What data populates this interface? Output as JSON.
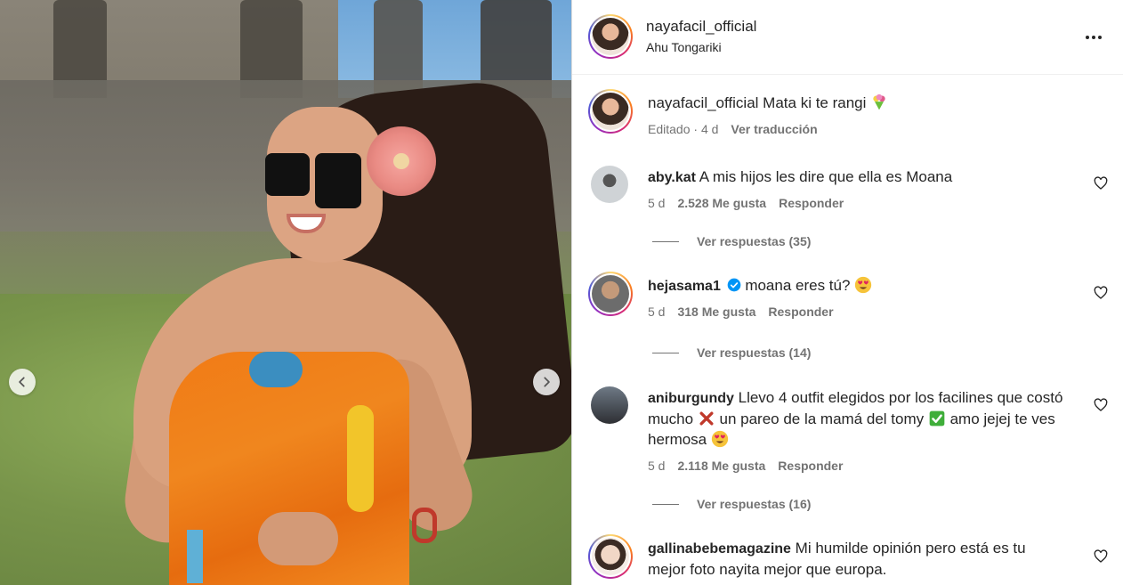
{
  "post": {
    "author": "nayafacil_official",
    "location": "Ahu Tongariki",
    "caption": {
      "username": "nayafacil_official",
      "text": "Mata ki te rangi",
      "emoji": "bouquet-icon",
      "edited_label": "Editado",
      "age": "4 d",
      "translate_label": "Ver traducción"
    }
  },
  "comments": [
    {
      "username": "aby.kat",
      "text": "A mis hijos les dire que ella es Moana",
      "age": "5 d",
      "likes": "2.528 Me gusta",
      "reply_label": "Responder",
      "view_replies": "Ver respuestas (35)"
    },
    {
      "username": "hejasama1",
      "verified": true,
      "text": "moana eres tú?",
      "emoji": "heart-eyes-icon",
      "age": "5 d",
      "likes": "318 Me gusta",
      "reply_label": "Responder",
      "view_replies": "Ver respuestas (14)"
    },
    {
      "username": "aniburgundy",
      "text_1": "Llevo 4 outfit elegidos por los facilines que costó mucho",
      "text_2": "un pareo de la mamá del tomy",
      "text_3": "amo jejej te ves hermosa",
      "age": "5 d",
      "likes": "2.118 Me gusta",
      "reply_label": "Responder",
      "view_replies": "Ver respuestas (16)"
    },
    {
      "username": "gallinabebemagazine",
      "text": "Mi humilde opinión pero está es tu mejor foto nayita mejor que europa."
    }
  ],
  "colors": {
    "text": "#262626",
    "secondary": "#737373",
    "verified": "#0095f6"
  }
}
